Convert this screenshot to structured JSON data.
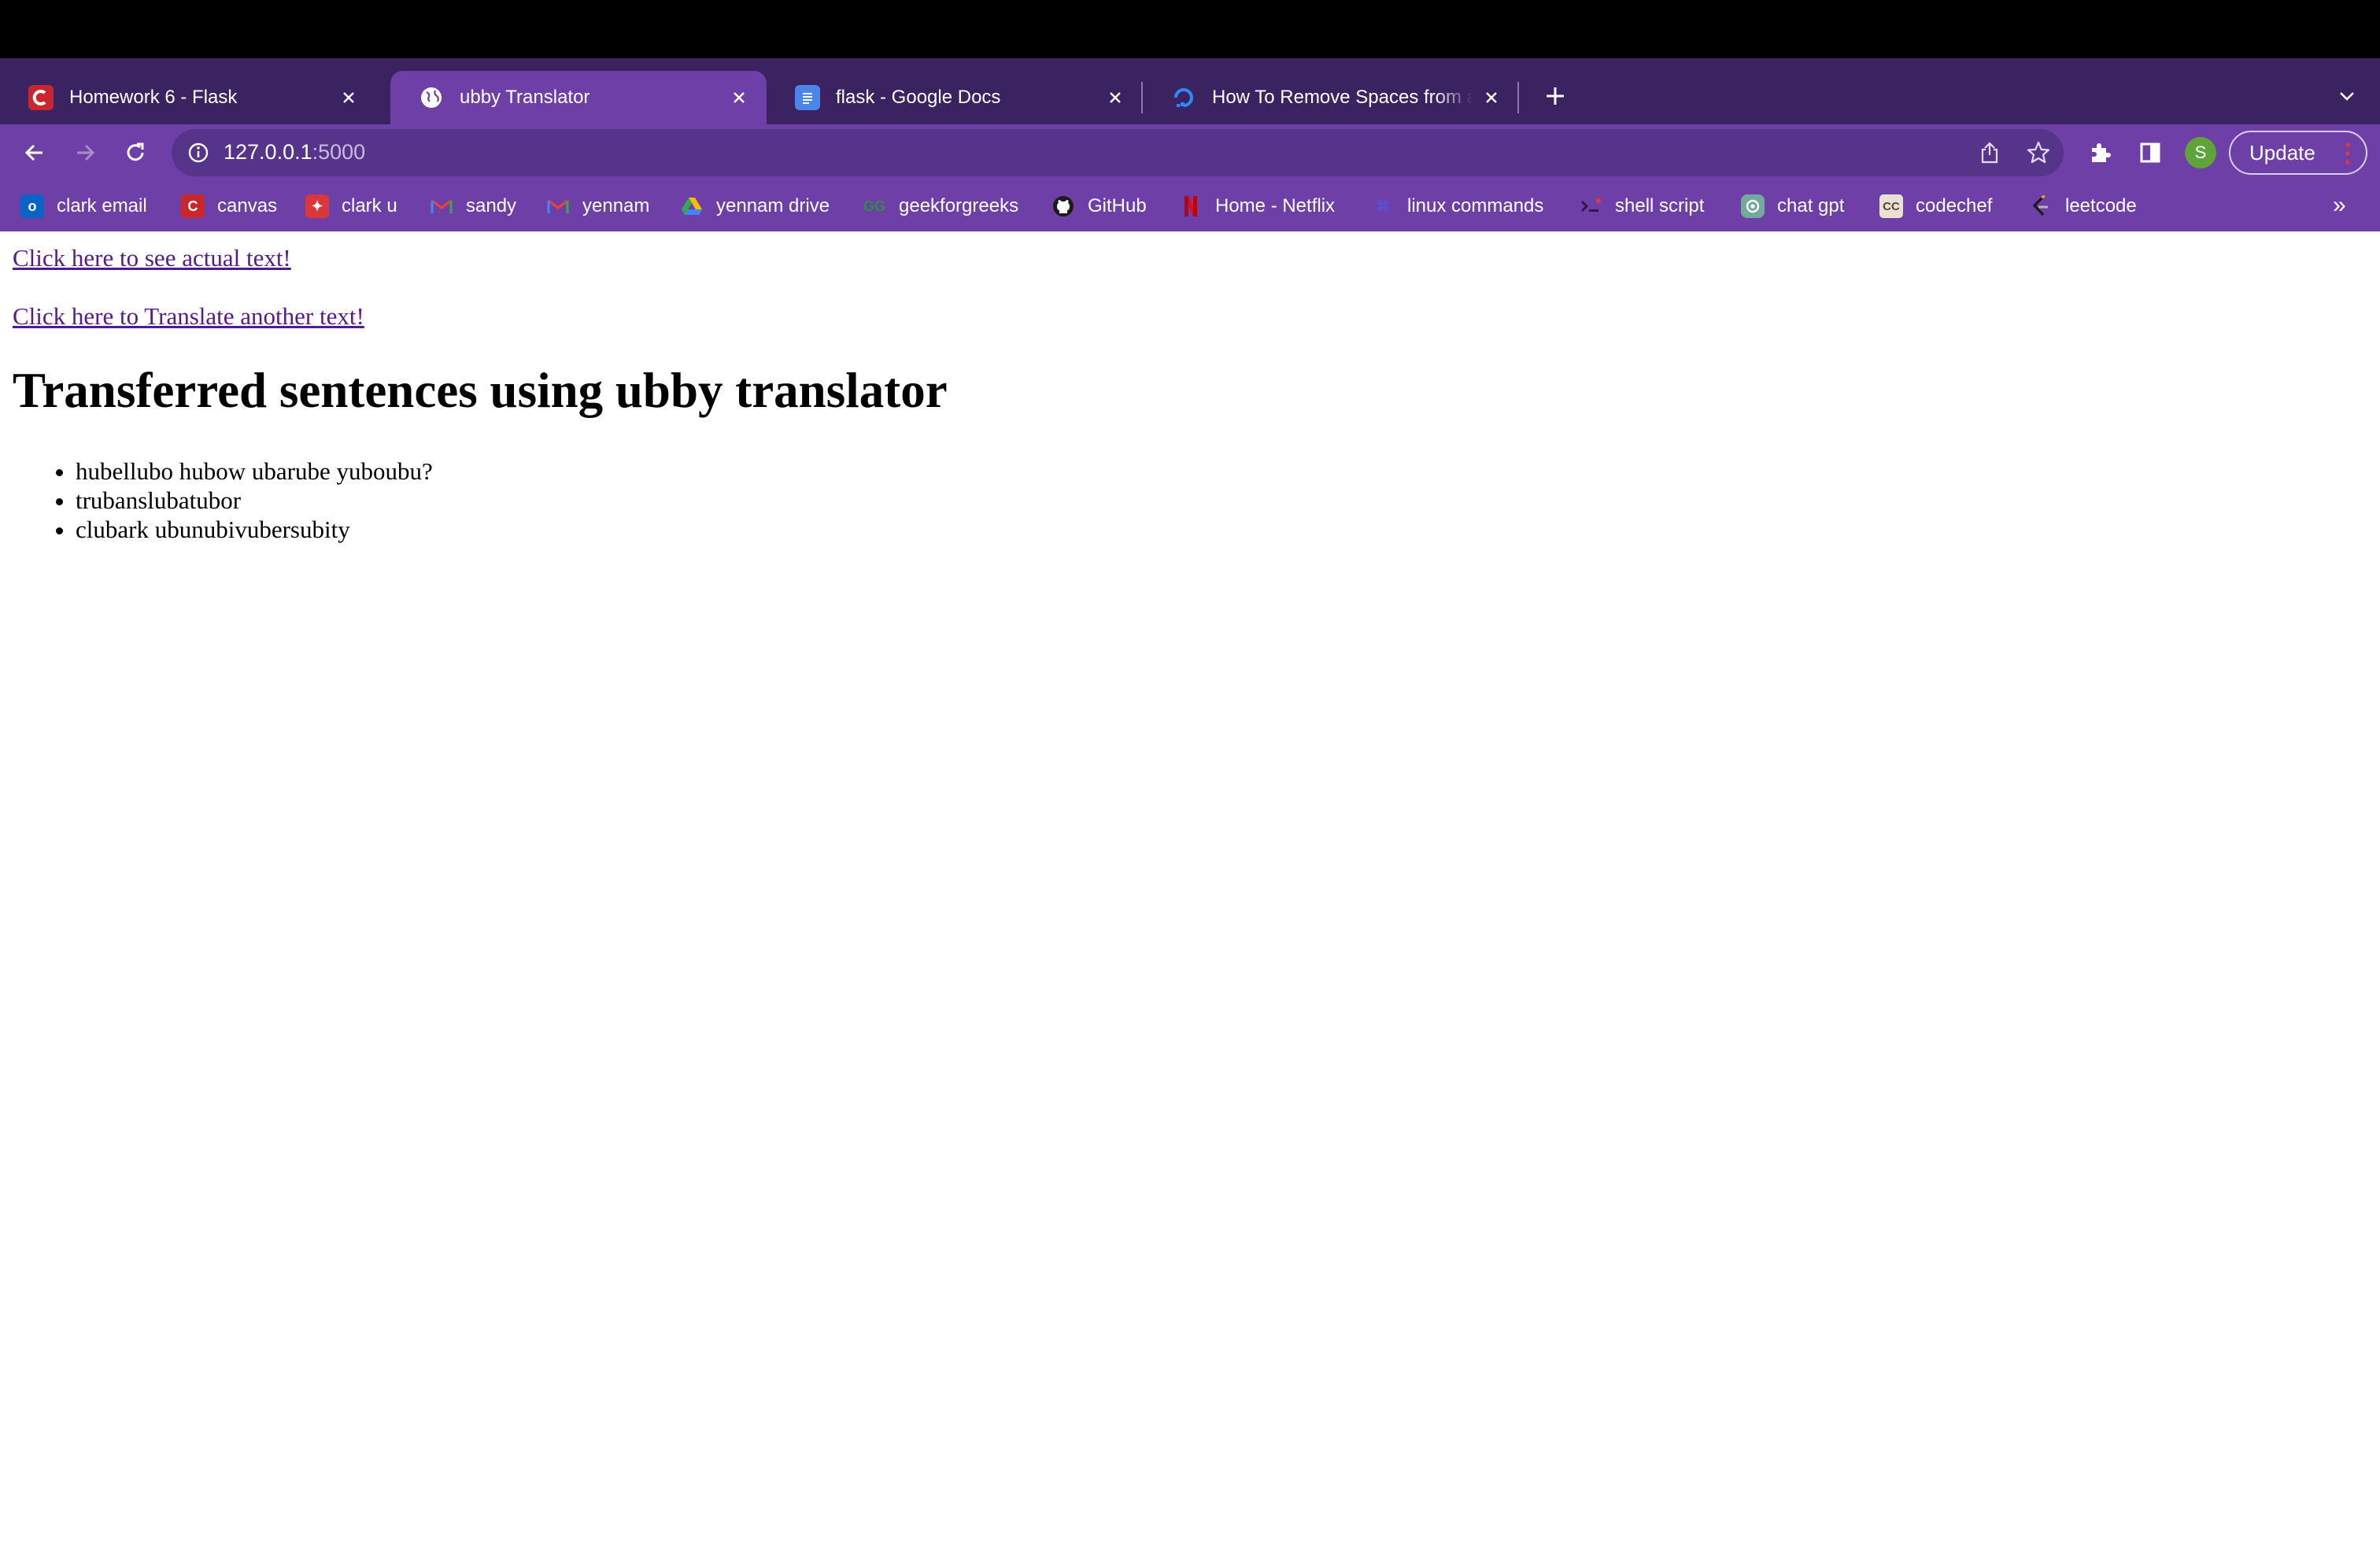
{
  "browser": {
    "tabs": [
      {
        "title": "Homework 6 - Flask",
        "icon": "canvas-c-icon",
        "active": false
      },
      {
        "title": "ubby Translator",
        "icon": "globe-icon",
        "active": true
      },
      {
        "title": "flask - Google Docs",
        "icon": "google-docs-icon",
        "active": false
      },
      {
        "title": "How To Remove Spaces from a",
        "icon": "digitalocean-icon",
        "active": false
      }
    ],
    "address": {
      "host": "127.0.0.1",
      "port": ":5000"
    },
    "profile_initial": "S",
    "update_label": "Update",
    "bookmarks": [
      {
        "label": "clark email",
        "icon": "outlook-icon"
      },
      {
        "label": "canvas",
        "icon": "canvas-c-icon"
      },
      {
        "label": "clark u",
        "icon": "clark-u-icon"
      },
      {
        "label": "sandy",
        "icon": "gmail-icon"
      },
      {
        "label": "yennam",
        "icon": "gmail-icon"
      },
      {
        "label": "yennam drive",
        "icon": "google-drive-icon"
      },
      {
        "label": "geekforgreeks",
        "icon": "geeksforgeeks-icon"
      },
      {
        "label": "GitHub",
        "icon": "github-icon"
      },
      {
        "label": "Home - Netflix",
        "icon": "netflix-icon"
      },
      {
        "label": "linux commands",
        "icon": "linux-icon"
      },
      {
        "label": "shell script",
        "icon": "shell-icon"
      },
      {
        "label": "chat gpt",
        "icon": "chatgpt-icon"
      },
      {
        "label": "codechef",
        "icon": "codechef-icon"
      },
      {
        "label": "leetcode",
        "icon": "leetcode-icon"
      }
    ],
    "more_bookmarks": "»"
  },
  "page": {
    "link_actual": "Click here to see actual text!",
    "link_translate": "Click here to Translate another text!",
    "heading": "Transferred sentences using ubby translator",
    "sentences": [
      "hubellubo hubow ubarube yuboubu?",
      "trubanslubatubor",
      "clubark ubunubivubersubity"
    ]
  },
  "colors": {
    "tabstrip": "#3b2260",
    "toolbar": "#6d3fa7",
    "omnibox": "#563489",
    "link": "#551a8b"
  }
}
